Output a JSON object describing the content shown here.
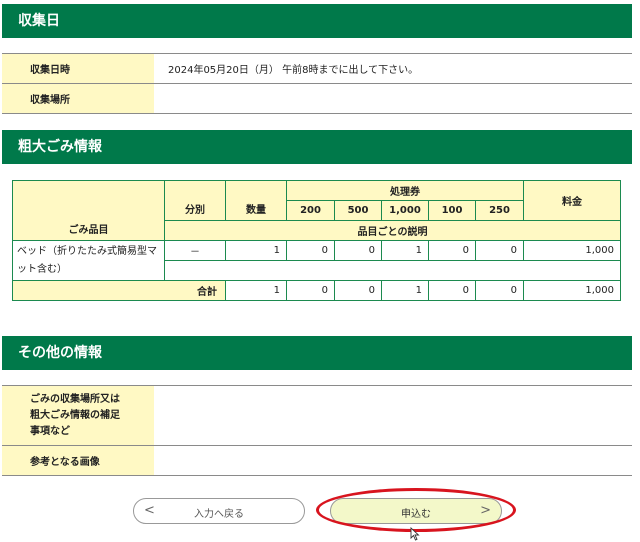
{
  "collection": {
    "header": "収集日",
    "datetime_label": "収集日時",
    "datetime_value": "2024年05月20日（月） 午前8時までに出して下さい。",
    "place_label": "収集場所",
    "place_value": ""
  },
  "bulky": {
    "header": "粗大ごみ情報",
    "columns": {
      "item": "ごみ品目",
      "category": "分別",
      "quantity": "数量",
      "tickets": "処理券",
      "fee": "料金",
      "description": "品目ごとの説明"
    },
    "ticket_types": [
      "200",
      "500",
      "1,000",
      "100",
      "250"
    ],
    "rows": [
      {
        "item": "ベッド（折りたたみ式簡易型マット含む）",
        "category": "－",
        "quantity": "1",
        "tickets": [
          "0",
          "0",
          "1",
          "0",
          "0"
        ],
        "fee": "1,000",
        "description": ""
      }
    ],
    "total": {
      "label": "合計",
      "quantity": "1",
      "tickets": [
        "0",
        "0",
        "1",
        "0",
        "0"
      ],
      "fee": "1,000"
    }
  },
  "other": {
    "header": "その他の情報",
    "notes_label": "ごみの収集場所又は粗大ごみ情報の補足事項など",
    "notes_value": "",
    "image_label": "参考となる画像",
    "image_value": ""
  },
  "buttons": {
    "back_label": "入力へ戻る",
    "back_arrow": "<",
    "apply_label": "申込む",
    "apply_arrow": ">"
  },
  "colors": {
    "header_green": "#00794a",
    "label_yellow": "#fff9c4",
    "table_border_green": "#1c8a4f",
    "highlight_red": "#d8141e"
  }
}
